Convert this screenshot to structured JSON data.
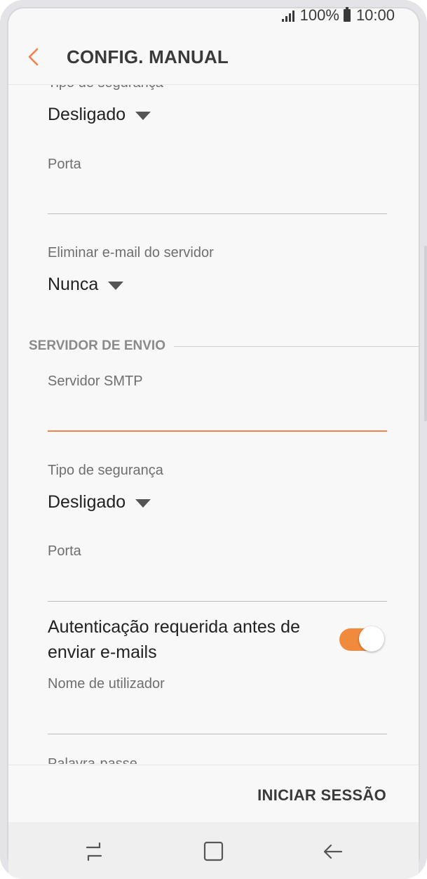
{
  "status": {
    "battery": "100%",
    "time": "10:00"
  },
  "header": {
    "title": "CONFIG. MANUAL"
  },
  "incoming": {
    "security_label": "Tipo de segurança",
    "security_value": "Desligado",
    "port_label": "Porta",
    "port_value": "",
    "delete_label": "Eliminar e-mail do servidor",
    "delete_value": "Nunca"
  },
  "outgoing": {
    "section_title": "SERVIDOR DE ENVIO",
    "smtp_label": "Servidor SMTP",
    "smtp_value": "",
    "security_label": "Tipo de segurança",
    "security_value": "Desligado",
    "port_label": "Porta",
    "port_value": "",
    "auth_label": "Autenticação requerida antes de enviar e-mails",
    "auth_enabled": true,
    "username_label": "Nome de utilizador",
    "username_value": "",
    "password_label": "Palavra-passe"
  },
  "actions": {
    "sign_in": "INICIAR SESSÃO"
  },
  "colors": {
    "accent": "#f0824a",
    "toggle_on": "#f28a3e"
  },
  "nav": {
    "recent_icon": "recent-apps-icon",
    "home_icon": "home-icon",
    "back_icon": "back-icon"
  }
}
